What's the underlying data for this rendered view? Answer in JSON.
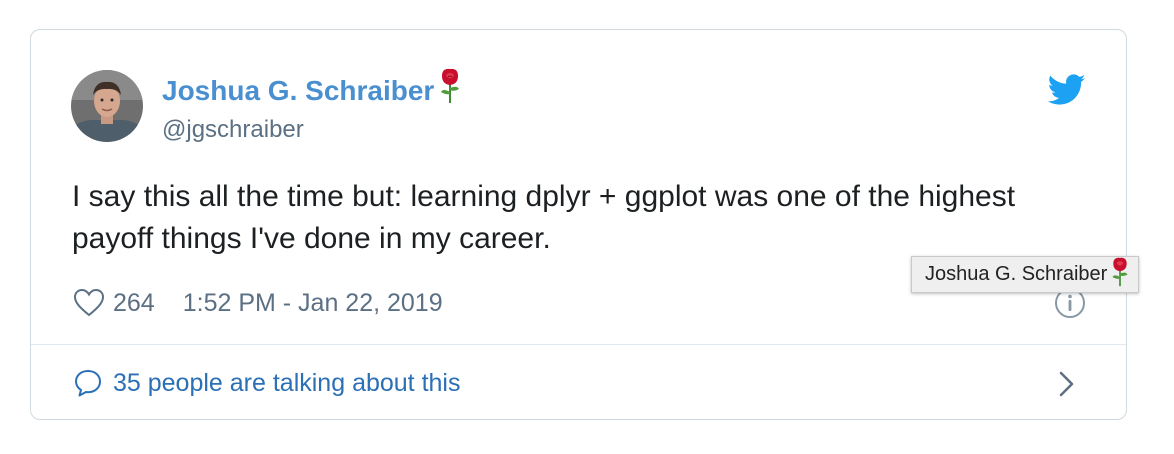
{
  "tweet": {
    "display_name": "Joshua G. Schraiber",
    "handle": "@jgschraiber",
    "text": "I say this all the time but: learning dplyr + ggplot was one of the highest payoff things I've done in my career.",
    "like_count": "264",
    "timestamp": "1:52 PM - Jan 22, 2019",
    "conversation_link": "35 people are talking about this",
    "name_emoji": "rose-icon"
  },
  "tooltip": {
    "text": "Joshua G. Schraiber",
    "emoji": "rose-icon"
  },
  "icons": {
    "brand": "twitter-bird-icon",
    "like": "heart-icon",
    "info": "info-icon",
    "reply": "speech-bubble-icon",
    "more": "chevron-right-icon"
  },
  "colors": {
    "name": "#4a8fcf",
    "link": "#2b6fb5",
    "twitter_blue": "#1da1f2",
    "secondary_text": "#5b7083",
    "border": "#cfd9de"
  }
}
